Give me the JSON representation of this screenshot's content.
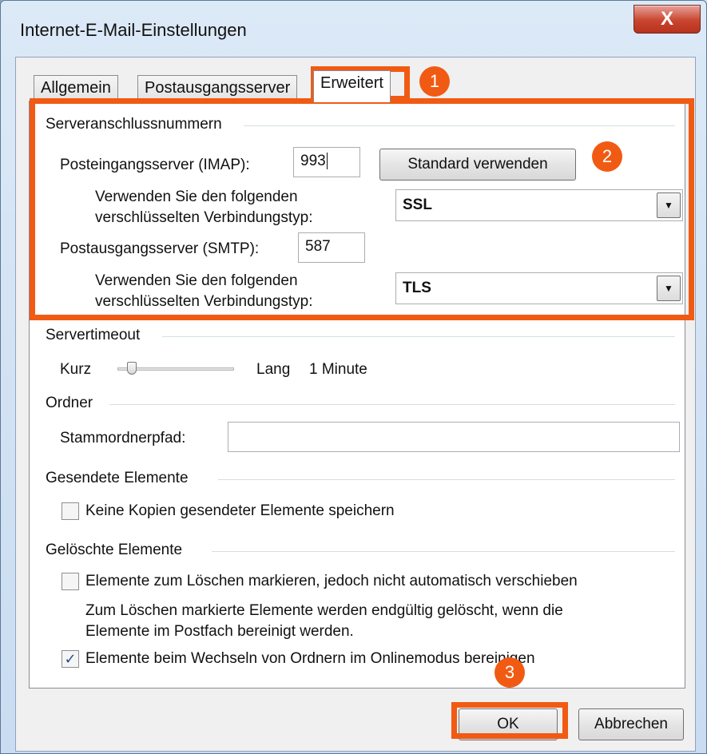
{
  "window": {
    "title": "Internet-E-Mail-Einstellungen",
    "close_glyph": "X"
  },
  "tabs": [
    {
      "label": "Allgemein",
      "active": false
    },
    {
      "label": "Postausgangsserver",
      "active": false
    },
    {
      "label": "Erweitert",
      "active": true
    }
  ],
  "server_ports": {
    "group_label": "Serveranschlussnummern",
    "imap": {
      "label": "Posteingangsserver (IMAP):",
      "value": "993",
      "default_button": "Standard verwenden",
      "encryption_label_line1": "Verwenden Sie den folgenden",
      "encryption_label_line2": "verschlüsselten Verbindungstyp:",
      "encryption_value": "SSL"
    },
    "smtp": {
      "label": "Postausgangsserver (SMTP):",
      "value": "587",
      "encryption_label_line1": "Verwenden Sie den folgenden",
      "encryption_label_line2": "verschlüsselten Verbindungstyp:",
      "encryption_value": "TLS"
    }
  },
  "timeout": {
    "group_label": "Servertimeout",
    "short_label": "Kurz",
    "long_label": "Lang",
    "value_text": "1 Minute"
  },
  "folders": {
    "group_label": "Ordner",
    "root_path_label": "Stammordnerpfad:",
    "root_path_value": ""
  },
  "sent_items": {
    "group_label": "Gesendete Elemente",
    "no_copies_label": "Keine Kopien gesendeter Elemente speichern",
    "no_copies_checked": false
  },
  "deleted_items": {
    "group_label": "Gelöschte Elemente",
    "mark_label": "Elemente zum Löschen markieren, jedoch nicht automatisch verschieben",
    "mark_checked": false,
    "note_line1": "Zum Löschen markierte Elemente werden endgültig gelöscht, wenn die",
    "note_line2": "Elemente im Postfach bereinigt werden.",
    "purge_label": "Elemente beim Wechseln von Ordnern im Onlinemodus bereinigen",
    "purge_checked": true
  },
  "buttons": {
    "ok": "OK",
    "cancel": "Abbrechen"
  },
  "annotations": {
    "badge1": "1",
    "badge2": "2",
    "badge3": "3",
    "color": "#f15a13"
  }
}
